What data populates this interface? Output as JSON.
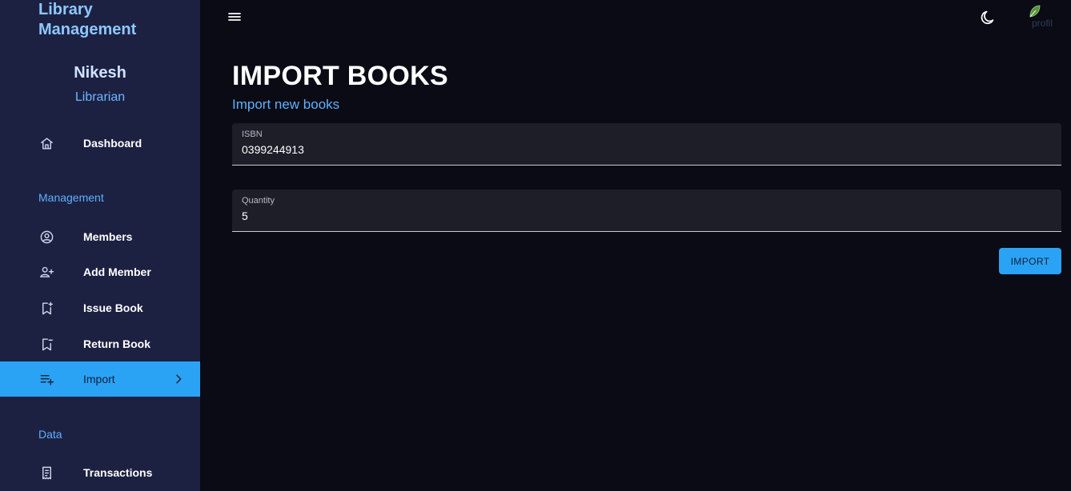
{
  "sidebar": {
    "brand_line1": "Library",
    "brand_line2": "Management",
    "user": {
      "name": "Nikesh",
      "role": "Librarian"
    },
    "dashboard": "Dashboard",
    "section_management": "Management",
    "members": "Members",
    "add_member": "Add Member",
    "issue_book": "Issue Book",
    "return_book": "Return Book",
    "import": "Import",
    "section_data": "Data",
    "transactions": "Transactions"
  },
  "topbar": {
    "menu_icon": "hamburger-menu-icon",
    "theme_icon": "moon-icon",
    "avatar_alt": "profil"
  },
  "page": {
    "title": "IMPORT BOOKS",
    "subtitle": "Import new books"
  },
  "form": {
    "isbn_label": "ISBN",
    "isbn_value": "0399244913",
    "quantity_label": "Quantity",
    "quantity_value": "5",
    "submit_label": "IMPORT"
  },
  "colors": {
    "sidebar_bg": "#1c2142",
    "main_bg": "#0a0b14",
    "accent": "#2ba3f5",
    "field_bg": "#1d1e28"
  }
}
